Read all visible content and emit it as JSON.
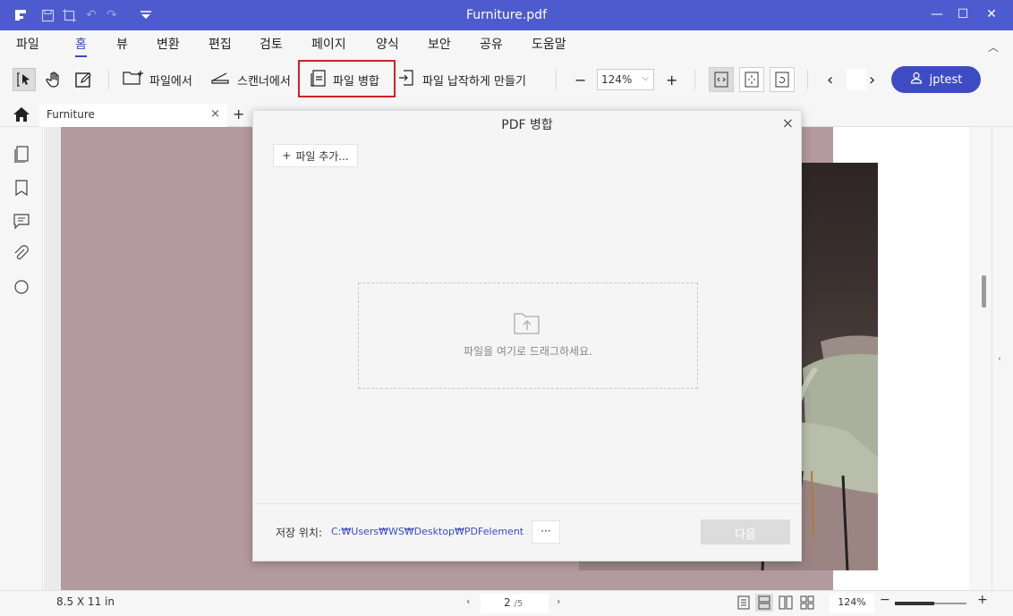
{
  "titlebar": {
    "title": "Furniture.pdf",
    "minimize": "—",
    "maximize": "☐",
    "close": "✕"
  },
  "menu": {
    "items": [
      "파일",
      "홈",
      "뷰",
      "변환",
      "편집",
      "검토",
      "페이지",
      "양식",
      "보안",
      "공유",
      "도움말"
    ],
    "active": "홈"
  },
  "toolbar": {
    "from_file": "파일에서",
    "from_scanner": "스캔너에서",
    "merge": "파일 병합",
    "fit": "파일 납작하게 만들기",
    "zoom_minus": "−",
    "zoom_value": "124%",
    "zoom_plus": "+",
    "prev": "‹",
    "next": "›",
    "user": "jptest"
  },
  "tabs": {
    "items": [
      {
        "label": "Furniture"
      }
    ],
    "close": "×",
    "add": "+"
  },
  "status": {
    "page_size": "8.5 X 11 in",
    "prev_page": "‹",
    "next_page": "›",
    "current_page": "2",
    "total_pages": "/5",
    "zoom": "124%",
    "zoom_minus": "−",
    "zoom_plus": "+",
    "zoom_level": 0.55
  },
  "dialog": {
    "title": "PDF 병합",
    "close": "×",
    "add_file": "파일 추가...",
    "add_icon": "+",
    "drop_text": "파일을 여기로 드래그하세요.",
    "save_label": "저장 위치:",
    "save_path": "C:₩Users₩WS₩Desktop₩PDFelement ...",
    "browse": "···",
    "next": "다음"
  },
  "colors": {
    "titlebar": "#4e5bcf",
    "accent": "#3b4ac1",
    "highlight": "#d0202a",
    "page": "#b29a9f"
  }
}
